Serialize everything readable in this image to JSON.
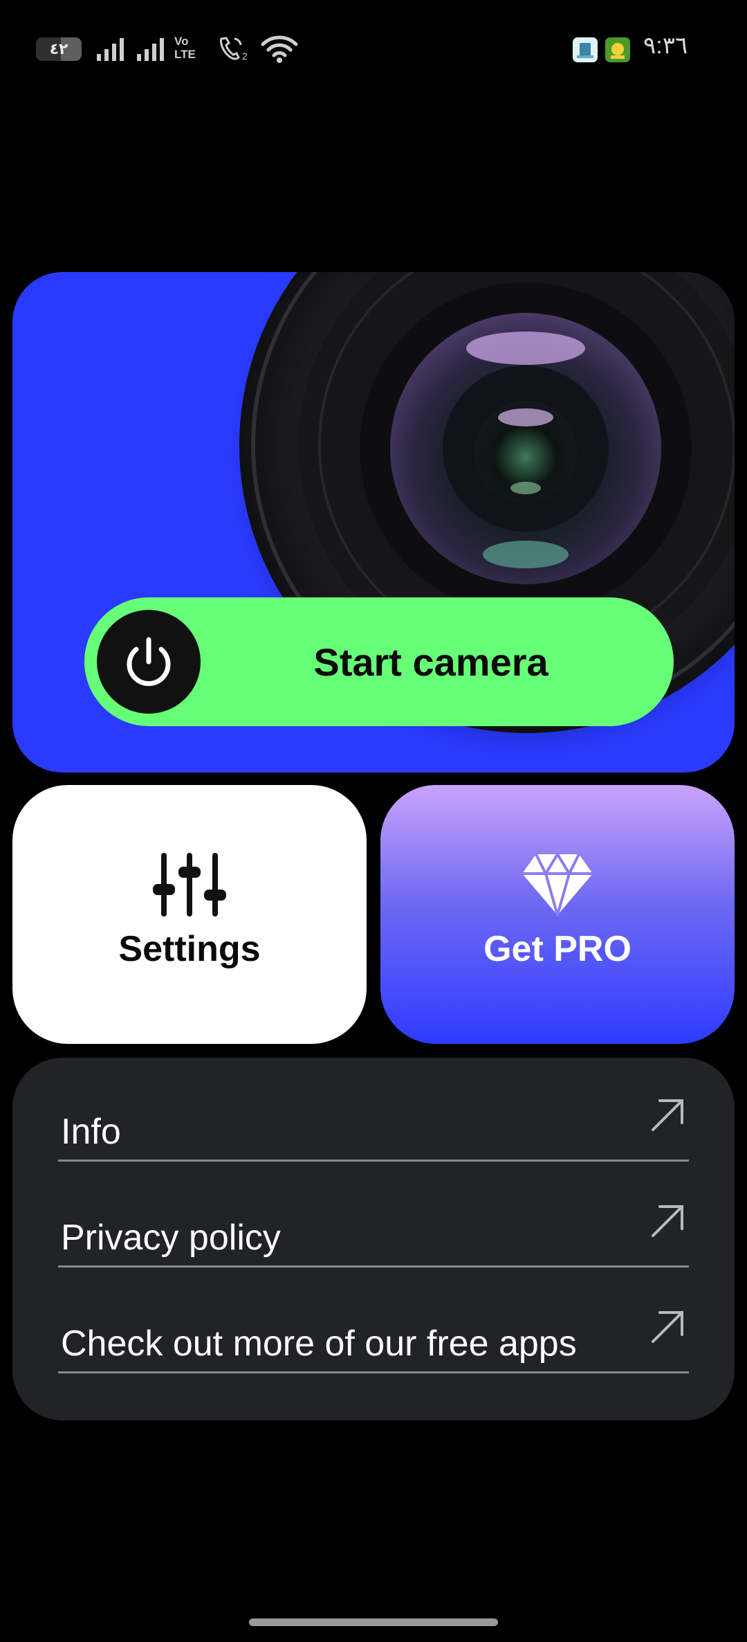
{
  "status_bar": {
    "battery_level": "٤٢",
    "network_label_top": "Vo",
    "network_label_bottom": "LTE",
    "clock": "٩:٣٦"
  },
  "hero": {
    "start_button_label": "Start camera",
    "background_color": "#2a3bff",
    "button_color": "#66ff77"
  },
  "tiles": {
    "settings_label": "Settings",
    "pro_label": "Get PRO"
  },
  "links": [
    {
      "label": "Info"
    },
    {
      "label": "Privacy policy"
    },
    {
      "label": "Check out more of our free apps"
    }
  ],
  "icons": {
    "power": "power-icon",
    "settings": "sliders-icon",
    "pro": "diamond-icon",
    "link": "arrow-up-right-icon"
  }
}
